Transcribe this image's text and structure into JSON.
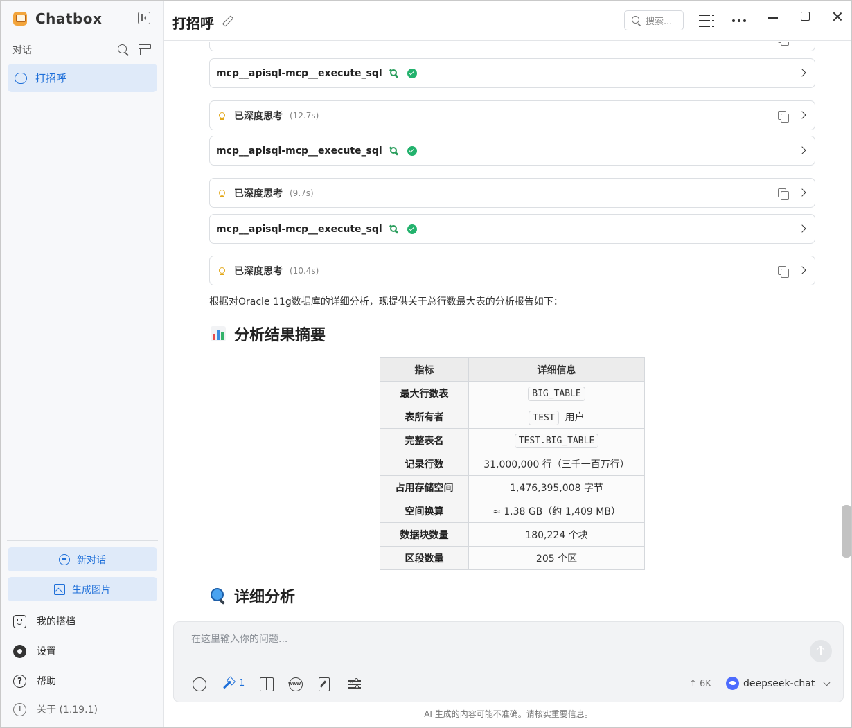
{
  "sidebar": {
    "app_name": "Chatbox",
    "section_label": "对话",
    "conversations": [
      {
        "label": "打招呼",
        "active": true
      }
    ],
    "actions": {
      "new_chat": "新对话",
      "generate_image": "生成图片"
    },
    "menu": {
      "copilots": "我的搭档",
      "settings": "设置",
      "help": "帮助",
      "about": "关于 (1.19.1)"
    }
  },
  "header": {
    "title": "打招呼",
    "search_placeholder": "搜索..."
  },
  "messages": {
    "blocks": [
      {
        "type": "tool",
        "name": "mcp__apisql-mcp__execute_sql"
      },
      {
        "type": "thinking",
        "label": "已深度思考",
        "time": "(12.7s)"
      },
      {
        "type": "tool",
        "name": "mcp__apisql-mcp__execute_sql"
      },
      {
        "type": "thinking",
        "label": "已深度思考",
        "time": "(9.7s)"
      },
      {
        "type": "tool",
        "name": "mcp__apisql-mcp__execute_sql"
      },
      {
        "type": "thinking",
        "label": "已深度思考",
        "time": "(10.4s)"
      }
    ],
    "intro": "根据对Oracle 11g数据库的详细分析，现提供关于总行数最大表的分析报告如下：",
    "summary_heading": "分析结果摘要",
    "detail_heading": "详细分析",
    "table": {
      "headers": [
        "指标",
        "详细信息"
      ],
      "rows": [
        {
          "key": "最大行数表",
          "code": "BIG_TABLE",
          "text": ""
        },
        {
          "key": "表所有者",
          "code": "TEST",
          "text": "用户"
        },
        {
          "key": "完整表名",
          "code": "TEST.BIG_TABLE",
          "text": ""
        },
        {
          "key": "记录行数",
          "code": "",
          "text": "31,000,000 行（三千一百万行）"
        },
        {
          "key": "占用存储空间",
          "code": "",
          "text": "1,476,395,008 字节"
        },
        {
          "key": "空间换算",
          "code": "",
          "text": "≈ 1.38 GB（约 1,409 MB）"
        },
        {
          "key": "数据块数量",
          "code": "",
          "text": "180,224 个块"
        },
        {
          "key": "区段数量",
          "code": "",
          "text": "205 个区"
        }
      ]
    }
  },
  "composer": {
    "placeholder": "在这里输入你的问题...",
    "tool_count": "1",
    "token_count": "↑ 6K",
    "model": "deepseek-chat",
    "disclaimer": "AI 生成的内容可能不准确。请核实重要信息。"
  },
  "colors": {
    "accent": "#1e6fd9",
    "active_bg": "#dfeaf9",
    "success": "#23b26d",
    "bulb": "#e3a81a"
  }
}
